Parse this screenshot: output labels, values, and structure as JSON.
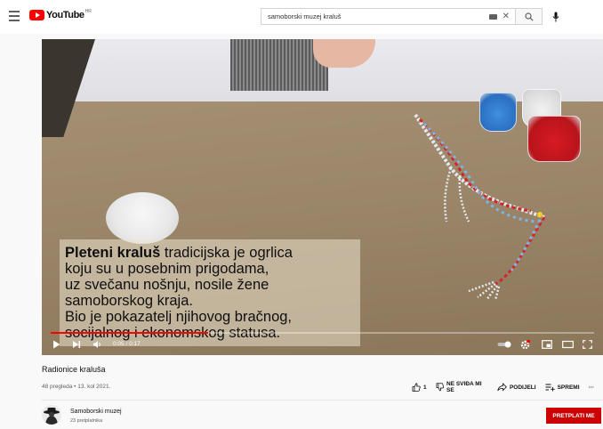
{
  "header": {
    "logo_text": "YouTube",
    "logo_region": "HR",
    "search_value": "samoborski muzej kraluš",
    "icons": [
      "menu-icon",
      "keyboard-icon",
      "clear-icon",
      "search-icon",
      "mic-icon"
    ]
  },
  "player": {
    "caption_lines": [
      {
        "bold": "Pleteni kraluš",
        "rest": " tradicijska je ogrlica"
      },
      {
        "bold": "",
        "rest": "koju su u posebnim prigodama,"
      },
      {
        "bold": "",
        "rest": "uz svečanu nošnju, nosile žene"
      },
      {
        "bold": "",
        "rest": "samoborskog kraja."
      },
      {
        "bold": "",
        "rest": "Bio je pokazatelj njihovog bračnog,"
      },
      {
        "bold": "",
        "rest": "socijalnog i ekonomskog statusa."
      }
    ],
    "time_current": "0:05",
    "time_total": "0:17",
    "time_text": "0:05 / 0:17",
    "progress_fraction": 0.29,
    "colors": {
      "progress": "#ff0000",
      "accent": "#ff0000"
    }
  },
  "video": {
    "title": "Radionice kraluša",
    "meta": "48 pregleda • 13. kol 2021.",
    "like_count": "1",
    "dislike_label": "NE SVIĐA MI SE",
    "share_label": "PODIJELI",
    "save_label": "SPREMI",
    "more_label": "···"
  },
  "channel": {
    "name": "Samoborski muzej",
    "subscribers": "23 pretplatnika",
    "subscribe_label": "PRETPLATI ME",
    "subscribe_color": "#cc0000"
  }
}
